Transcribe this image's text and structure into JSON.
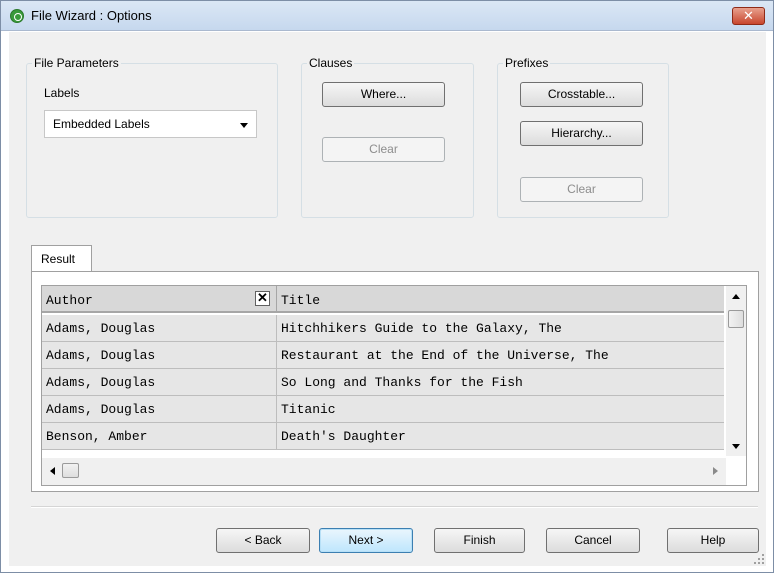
{
  "window": {
    "title": "File Wizard : Options",
    "close_label": "✕"
  },
  "file_parameters": {
    "legend": "File Parameters",
    "labels_caption": "Labels",
    "labels_selected": "Embedded Labels"
  },
  "clauses": {
    "legend": "Clauses",
    "where_label": "Where...",
    "clear_label": "Clear"
  },
  "prefixes": {
    "legend": "Prefixes",
    "crosstable_label": "Crosstable...",
    "hierarchy_label": "Hierarchy...",
    "clear_label": "Clear"
  },
  "result": {
    "tab_label": "Result",
    "columns": [
      "Author",
      "Title"
    ],
    "remove_column_label": "✕",
    "rows": [
      [
        "Adams, Douglas",
        "Hitchhikers Guide to the Galaxy, The"
      ],
      [
        "Adams, Douglas",
        "Restaurant at the End of the Universe, The"
      ],
      [
        "Adams, Douglas",
        "So Long and Thanks for the Fish"
      ],
      [
        "Adams, Douglas",
        "Titanic"
      ],
      [
        "Benson, Amber",
        "Death's Daughter"
      ]
    ]
  },
  "footer": {
    "back_label": "< Back",
    "next_label": "Next >",
    "finish_label": "Finish",
    "cancel_label": "Cancel",
    "help_label": "Help"
  }
}
